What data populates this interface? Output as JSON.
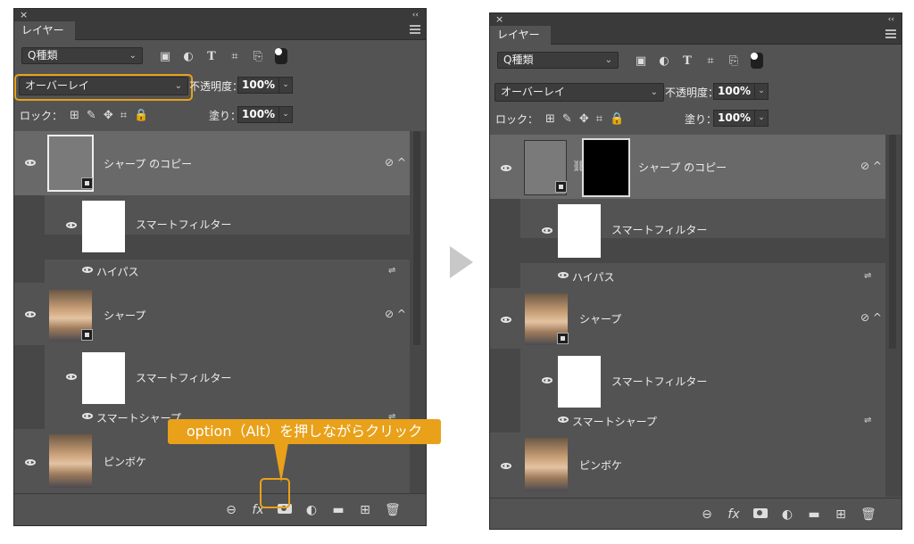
{
  "left_panel": {
    "close": "×",
    "collapse": "‹‹",
    "tab": "レイヤー",
    "filter": "種類",
    "blend_mode": "オーバーレイ",
    "opacity_label": "不透明度：",
    "opacity": "100%",
    "lock_label": "ロック：",
    "fill_label": "塗り：",
    "fill": "100%",
    "layers": {
      "copy": "シャープ のコピー",
      "smart_filter_1": "スマートフィルター",
      "highpass": "ハイパス",
      "sharp": "シャープ",
      "smart_filter_2": "スマートフィルター",
      "smart_sharpen": "スマートシャープ",
      "bokeh": "ピンボケ"
    }
  },
  "right_panel": {
    "close": "×",
    "collapse": "‹‹",
    "tab": "レイヤー",
    "filter": "種類",
    "blend_mode": "オーバーレイ",
    "opacity_label": "不透明度：",
    "opacity": "100%",
    "lock_label": "ロック：",
    "fill_label": "塗り：",
    "fill": "100%",
    "layers": {
      "copy": "シャープ のコピー",
      "smart_filter_1": "スマートフィルター",
      "highpass": "ハイパス",
      "sharp": "シャープ",
      "smart_filter_2": "スマートフィルター",
      "smart_sharpen": "スマートシャープ",
      "bokeh": "ピンボケ"
    }
  },
  "callout": "option（Alt）を押しながらクリック",
  "icons": {
    "search": "Q",
    "chevron": "⌄",
    "fx": "fx",
    "link": "⊖",
    "adjust": "◐",
    "folder": "▬",
    "new": "⊞",
    "trash": "🗑"
  },
  "colors": {
    "accent": "#e9a11a",
    "panel": "#535353",
    "selected_row": "#696969"
  }
}
